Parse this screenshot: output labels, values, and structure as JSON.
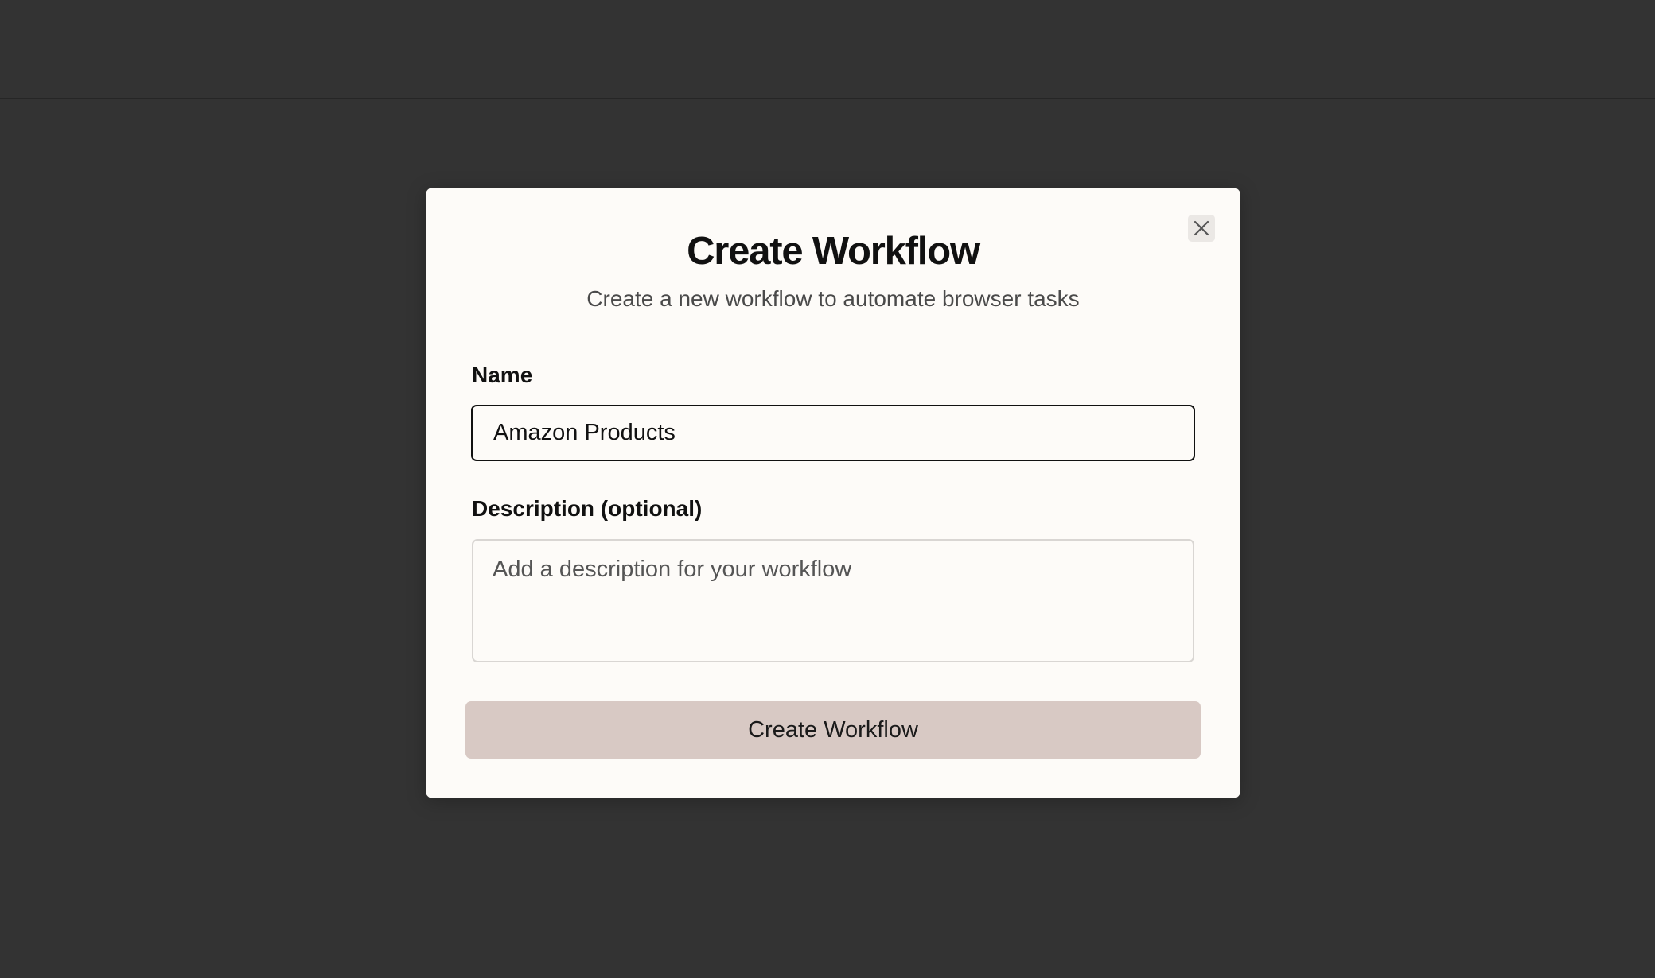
{
  "dialog": {
    "title": "Create Workflow",
    "subtitle": "Create a new workflow to automate browser tasks",
    "close_icon": "close-icon"
  },
  "form": {
    "name_label": "Name",
    "name_value": "Amazon Products",
    "description_label": "Description (optional)",
    "description_value": "",
    "description_placeholder": "Add a description for your workflow",
    "submit_label": "Create Workflow"
  },
  "colors": {
    "backdrop": "#333333",
    "dialog_background": "#fdfbf8",
    "submit_background": "#d8c9c4",
    "focus_border": "#111111"
  }
}
